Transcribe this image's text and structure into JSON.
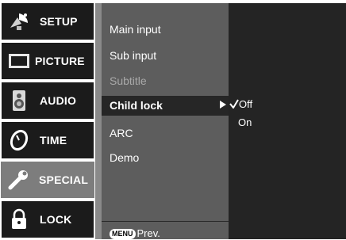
{
  "tabs": [
    {
      "label": "SETUP",
      "icon": "satellite-dish-icon",
      "active": false
    },
    {
      "label": "PICTURE",
      "icon": "monitor-icon",
      "active": false
    },
    {
      "label": "AUDIO",
      "icon": "speaker-icon",
      "active": false
    },
    {
      "label": "TIME",
      "icon": "clock-icon",
      "active": false
    },
    {
      "label": "SPECIAL",
      "icon": "wrench-icon",
      "active": true
    },
    {
      "label": "LOCK",
      "icon": "padlock-icon",
      "active": false
    }
  ],
  "submenu": {
    "items": [
      {
        "label": "Main input",
        "state": "normal"
      },
      {
        "label": "Sub input",
        "state": "normal"
      },
      {
        "label": "Subtitle",
        "state": "disabled"
      },
      {
        "label": "Child lock",
        "state": "selected"
      },
      {
        "label": "ARC",
        "state": "normal"
      },
      {
        "label": "Demo",
        "state": "normal"
      }
    ],
    "footer": {
      "key": "MENU",
      "label": "Prev."
    }
  },
  "options": {
    "items": [
      {
        "label": "Off",
        "checked": true
      },
      {
        "label": "On",
        "checked": false
      }
    ]
  },
  "colors": {
    "tab_bg": "#1b1b1b",
    "tab_active_bg": "#7d7d7d",
    "submenu_bg": "#5d5d5d",
    "selected_bg": "#262626",
    "options_bg": "#242424"
  }
}
